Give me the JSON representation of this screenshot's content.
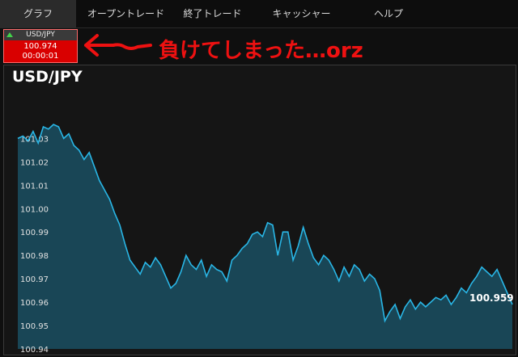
{
  "nav": {
    "tabs": [
      "グラフ",
      "オープントレード",
      "終了トレード",
      "キャッシャー",
      "ヘルプ"
    ],
    "active_index": 0
  },
  "ticker": {
    "symbol": "USD/JPY",
    "price": "100.974",
    "time": "00:00:01",
    "direction": "up",
    "bg_color": "#d90000"
  },
  "annotation": {
    "text": "負けてしまった…orz",
    "color": "#ee1111"
  },
  "chart_data": {
    "type": "area",
    "title": "USD/JPY",
    "ylim": [
      100.94,
      101.045
    ],
    "y_ticks": [
      "100.94",
      "100.95",
      "100.96",
      "100.97",
      "100.98",
      "100.99",
      "101.00",
      "101.01",
      "101.02",
      "101.03"
    ],
    "last_value_label": "100.959",
    "line_color": "#29b6e6",
    "fill_color": "#1a4f62",
    "values": [
      101.03,
      101.031,
      101.029,
      101.033,
      101.028,
      101.035,
      101.034,
      101.036,
      101.035,
      101.03,
      101.032,
      101.027,
      101.025,
      101.021,
      101.024,
      101.018,
      101.012,
      101.008,
      101.004,
      100.998,
      100.993,
      100.985,
      100.978,
      100.975,
      100.972,
      100.977,
      100.975,
      100.979,
      100.976,
      100.971,
      100.966,
      100.968,
      100.973,
      100.98,
      100.976,
      100.974,
      100.978,
      100.971,
      100.976,
      100.974,
      100.973,
      100.969,
      100.978,
      100.98,
      100.983,
      100.985,
      100.989,
      100.99,
      100.988,
      100.994,
      100.993,
      100.98,
      100.99,
      100.99,
      100.978,
      100.984,
      100.992,
      100.985,
      100.979,
      100.976,
      100.98,
      100.978,
      100.974,
      100.969,
      100.975,
      100.971,
      100.976,
      100.974,
      100.969,
      100.972,
      100.97,
      100.965,
      100.952,
      100.956,
      100.959,
      100.953,
      100.958,
      100.961,
      100.957,
      100.96,
      100.958,
      100.96,
      100.962,
      100.961,
      100.963,
      100.959,
      100.962,
      100.966,
      100.964,
      100.968,
      100.971,
      100.975,
      100.973,
      100.971,
      100.974,
      100.969,
      100.964,
      100.959
    ]
  }
}
